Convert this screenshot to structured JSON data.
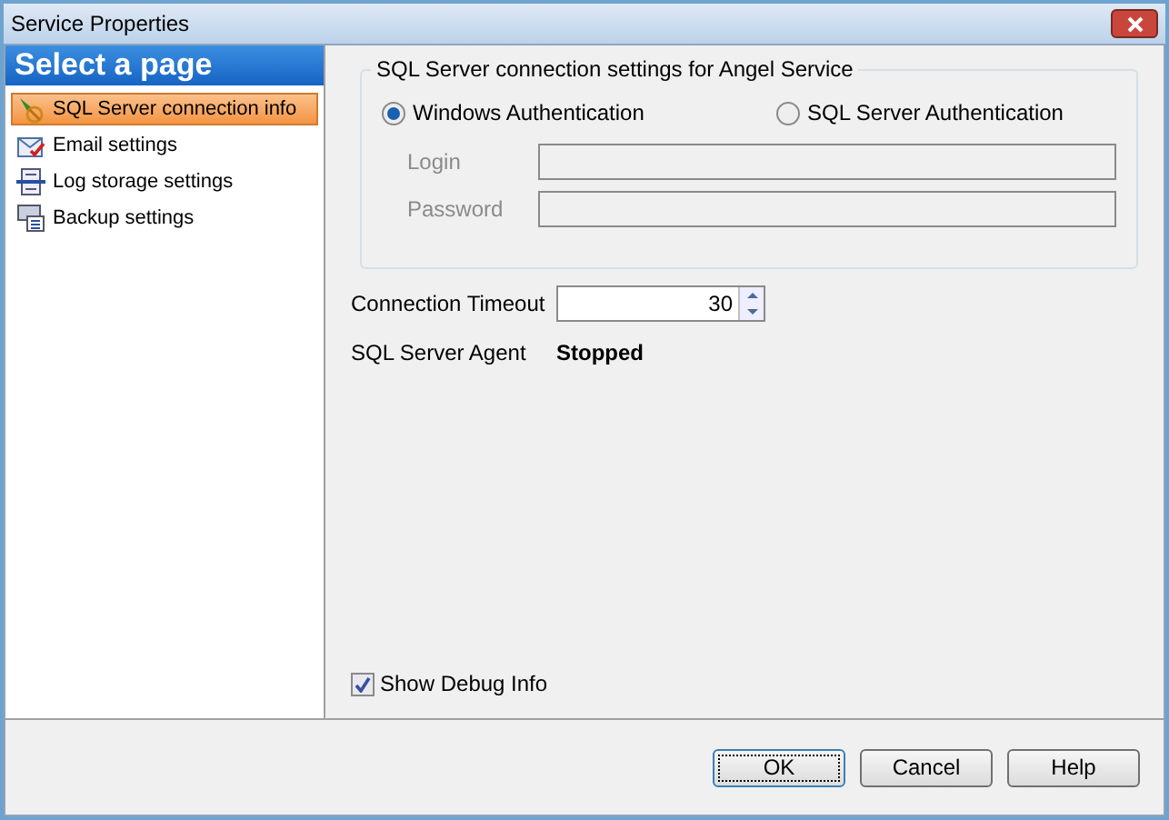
{
  "window": {
    "title": "Service Properties"
  },
  "sidebar": {
    "heading": "Select a page",
    "items": [
      {
        "label": "SQL Server connection info",
        "kind": "connection",
        "selected": true
      },
      {
        "label": "Email settings",
        "kind": "email",
        "selected": false
      },
      {
        "label": "Log storage settings",
        "kind": "log",
        "selected": false
      },
      {
        "label": "Backup settings",
        "kind": "backup",
        "selected": false
      }
    ]
  },
  "group": {
    "title": "SQL Server connection settings for Angel Service",
    "auth": [
      {
        "label": "Windows Authentication",
        "selected": true
      },
      {
        "label": "SQL Server Authentication",
        "selected": false
      }
    ],
    "fields": [
      {
        "label": "Login",
        "disabled": true
      },
      {
        "label": "Password",
        "disabled": true
      }
    ]
  },
  "timeout": {
    "label": "Connection Timeout",
    "value": "30"
  },
  "agent": {
    "label": "SQL Server Agent",
    "status": "Stopped"
  },
  "debug": {
    "label": "Show Debug Info",
    "checked": true
  },
  "buttons": [
    {
      "label": "OK",
      "default": true
    },
    {
      "label": "Cancel",
      "default": false
    },
    {
      "label": "Help",
      "default": false
    }
  ]
}
